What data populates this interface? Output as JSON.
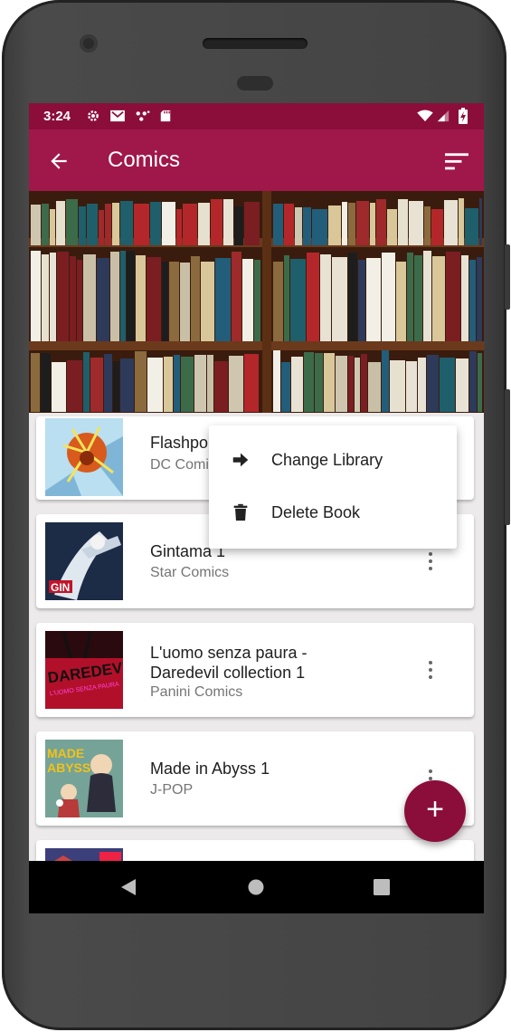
{
  "status_bar": {
    "time": "3:24"
  },
  "app_bar": {
    "title": "Comics"
  },
  "books": [
    {
      "title": "Flashpo",
      "publisher": "DC Comi"
    },
    {
      "title": "Gintama 1",
      "publisher": "Star Comics"
    },
    {
      "title_line1": "L'uomo senza paura -",
      "title_line2": "Daredevil collection 1",
      "publisher": "Panini Comics"
    },
    {
      "title": "Made in Abyss 1",
      "publisher": "J-POP"
    }
  ],
  "context_menu": {
    "items": [
      {
        "label": "Change Library",
        "icon": "arrow-right-icon"
      },
      {
        "label": "Delete Book",
        "icon": "trash-icon"
      }
    ]
  },
  "fab": {
    "label": "+"
  },
  "colors": {
    "primary": "#a0174a",
    "primary_dark": "#8b0d3a",
    "background": "#eceaea"
  }
}
